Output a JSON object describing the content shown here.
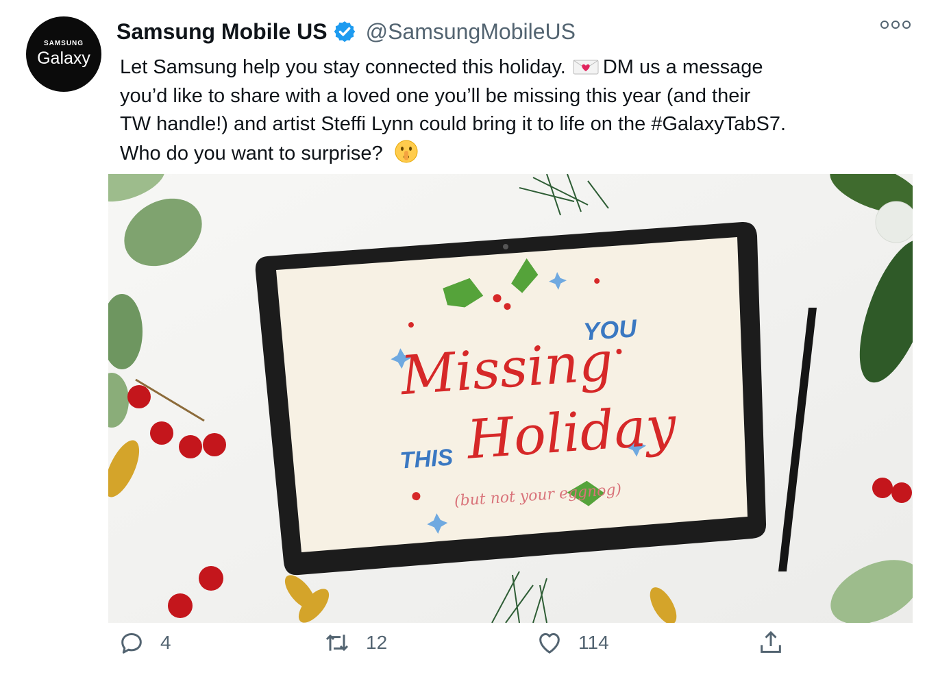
{
  "account": {
    "avatar_brand": "SAMSUNG",
    "avatar_product": "Galaxy",
    "display_name": "Samsung Mobile US",
    "handle": "@SamsungMobileUS",
    "verified": true
  },
  "tweet": {
    "line1_a": "Let Samsung help you stay connected this holiday.",
    "line1_b": "DM us a message",
    "line2": "you’d like to share with a loved one you’ll be missing this year (and their",
    "line3": "TW handle!) and artist Steffi Lynn could bring it to life on the #GalaxyTabS7.",
    "line4": "Who do you want to surprise?",
    "emojis": [
      "love-letter-emoji",
      "shushing-face-emoji"
    ]
  },
  "media": {
    "screen_text_1": "Missing",
    "screen_text_2": "YOU",
    "screen_text_3": "THIS",
    "screen_text_4": "Holiday",
    "screen_text_5": "(but not your eggnog)"
  },
  "actions": {
    "replies": "4",
    "retweets": "12",
    "likes": "114"
  },
  "colors": {
    "verified_blue": "#1d9bf0",
    "text_primary": "#0f1419",
    "text_secondary": "#536471",
    "lettering_red": "#d62828",
    "lettering_blue": "#3a78c2"
  }
}
